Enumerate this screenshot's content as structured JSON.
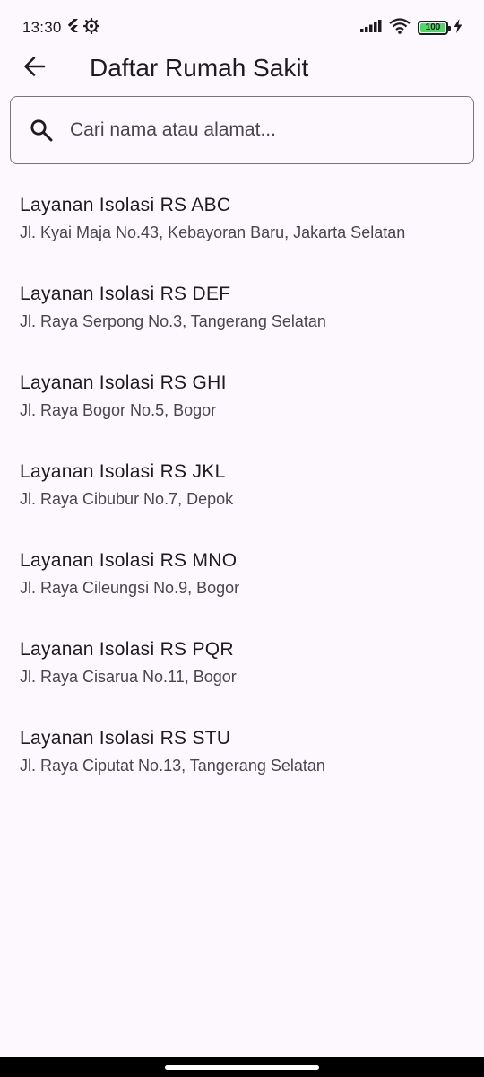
{
  "status_bar": {
    "time": "13:30",
    "battery": "100",
    "icons": [
      "flutter-icon",
      "settings-gear-icon",
      "signal-icon",
      "wifi-icon",
      "battery-icon",
      "charging-icon"
    ]
  },
  "app_bar": {
    "title": "Daftar Rumah Sakit",
    "back_icon": "arrow-back-icon"
  },
  "search": {
    "placeholder": "Cari nama atau alamat...",
    "value": "",
    "icon": "search-icon"
  },
  "hospitals": [
    {
      "name": "Layanan Isolasi RS ABC",
      "address": "Jl. Kyai Maja No.43, Kebayoran Baru, Jakarta Selatan"
    },
    {
      "name": "Layanan Isolasi RS DEF",
      "address": "Jl. Raya Serpong No.3, Tangerang Selatan"
    },
    {
      "name": "Layanan Isolasi RS GHI",
      "address": "Jl. Raya Bogor No.5, Bogor"
    },
    {
      "name": "Layanan Isolasi RS JKL",
      "address": "Jl. Raya Cibubur No.7, Depok"
    },
    {
      "name": "Layanan Isolasi RS MNO",
      "address": "Jl. Raya Cileungsi No.9, Bogor"
    },
    {
      "name": "Layanan Isolasi RS PQR",
      "address": "Jl. Raya Cisarua No.11, Bogor"
    },
    {
      "name": "Layanan Isolasi RS STU",
      "address": "Jl. Raya Ciputat No.13, Tangerang Selatan"
    }
  ],
  "colors": {
    "background": "#fdf7fe",
    "text_primary": "#1d1b20",
    "text_secondary": "#49454f",
    "outline": "#79747e",
    "battery": "#4cd964"
  }
}
